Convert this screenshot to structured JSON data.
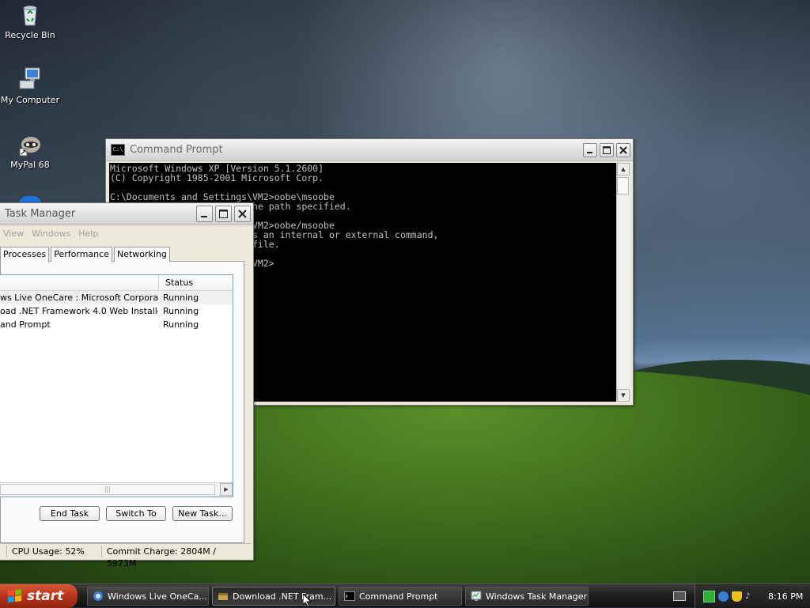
{
  "desktop": {
    "icons": [
      {
        "label": "Recycle Bin",
        "icon": "recycle-bin-icon"
      },
      {
        "label": "My Computer",
        "icon": "my-computer-icon"
      },
      {
        "label": "MyPal 68",
        "icon": "mypal-icon"
      }
    ]
  },
  "cmd": {
    "title": "Command Prompt",
    "lines": [
      "Microsoft Windows XP [Version 5.1.2600]",
      "(C) Copyright 1985-2001 Microsoft Corp.",
      "",
      "C:\\Documents and Settings\\VM2>oobe\\msoobe",
      "                         the path specified.",
      "",
      "                       gs\\VM2>oobe/msoobe",
      "                       d as an internal or external command,",
      "                       ch file.",
      "",
      "                       gs\\VM2>"
    ]
  },
  "taskmgr": {
    "title": "Task Manager",
    "menu": [
      "View",
      "Windows",
      "Help"
    ],
    "tabs": [
      "Processes",
      "Performance",
      "Networking"
    ],
    "columns": {
      "status": "Status"
    },
    "rows": [
      {
        "task": "ws Live OneCare : Microsoft Corporatio...",
        "status": "Running"
      },
      {
        "task": "oad .NET Framework 4.0 Web Installer ...",
        "status": "Running"
      },
      {
        "task": "and Prompt",
        "status": "Running"
      }
    ],
    "buttons": {
      "end_task": "End Task",
      "switch_to": "Switch To",
      "new_task": "New Task..."
    },
    "status": {
      "cpu": "CPU Usage: 52%",
      "commit": "Commit Charge: 2804M / 5973M"
    }
  },
  "taskbar": {
    "start": "start",
    "tasks": [
      {
        "label": "Windows Live OneCa..."
      },
      {
        "label": "Download .NET Fram..."
      },
      {
        "label": "Command Prompt"
      },
      {
        "label": "Windows Task Manager"
      }
    ],
    "clock": "8:16 PM"
  },
  "colors": {
    "start_button": "#b8321a",
    "console_bg": "#000000",
    "console_fg": "#c0c0c0"
  }
}
